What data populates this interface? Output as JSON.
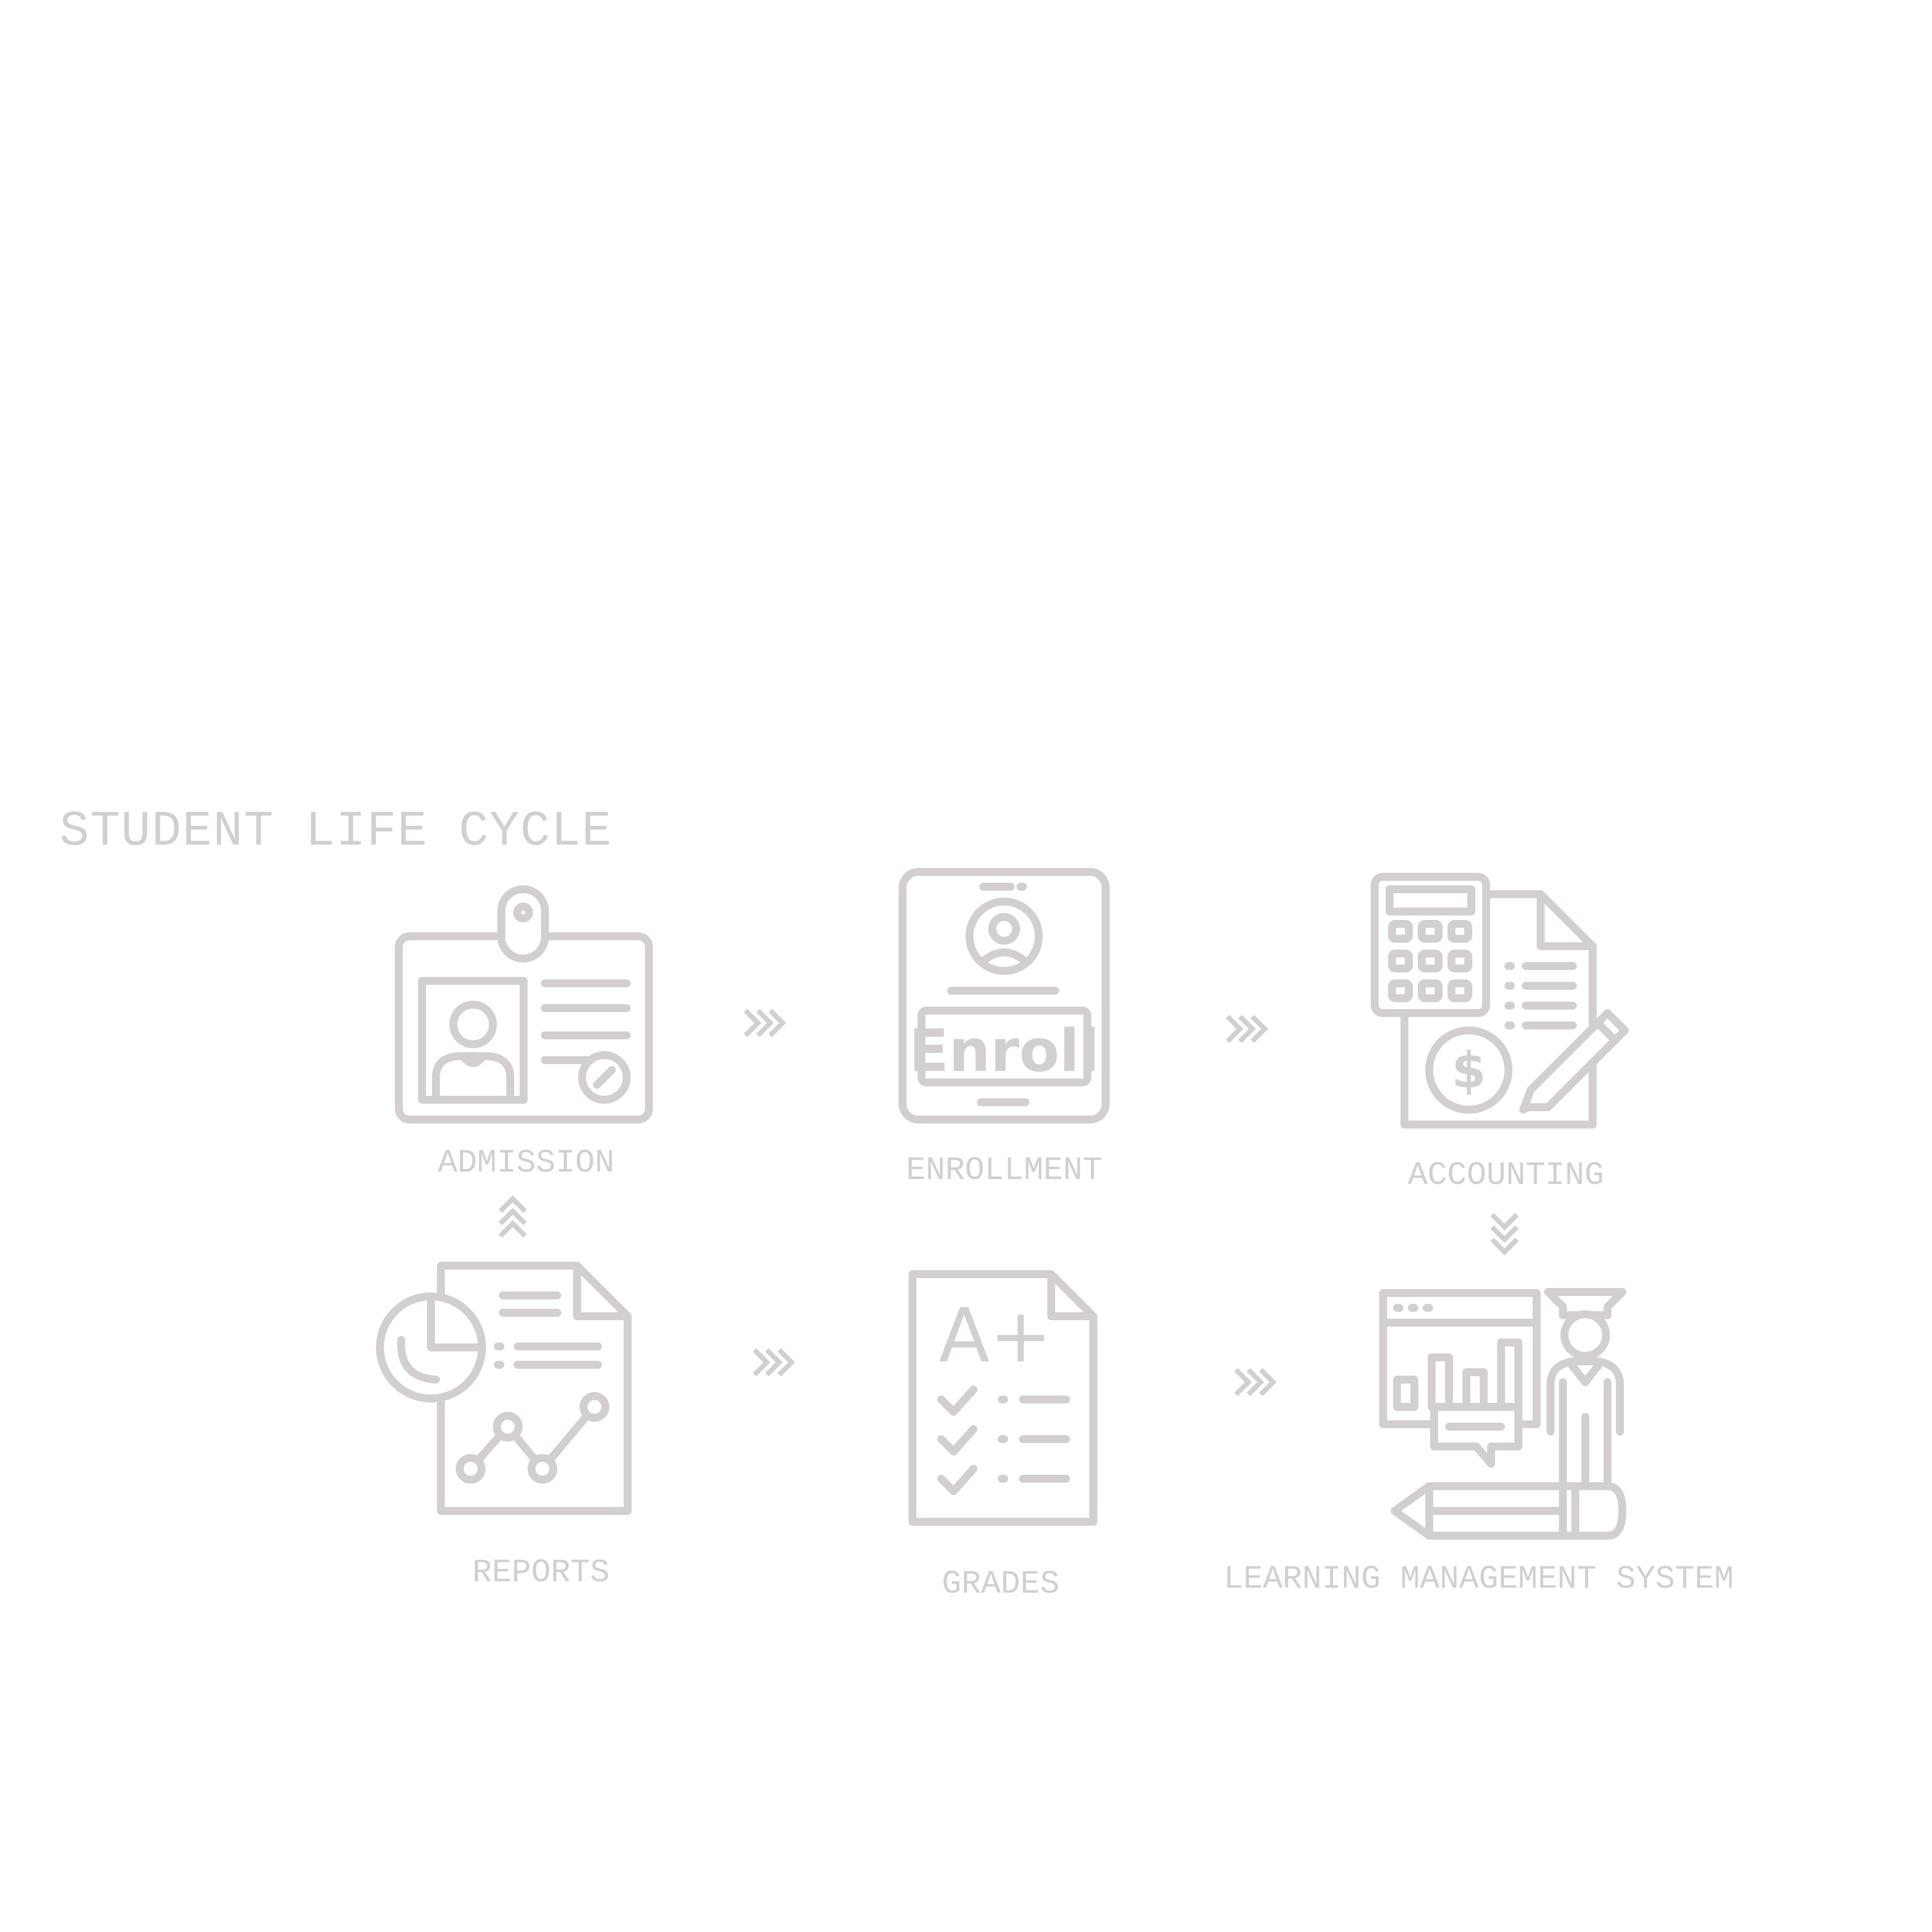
{
  "title": "STUDENT LIFE CYCLE",
  "colors": {
    "ink": "#d3cfcf",
    "background": "#ffffff"
  },
  "steps": [
    {
      "id": "admission",
      "label": "ADMISSION",
      "icon": "id-badge-icon"
    },
    {
      "id": "enrollment",
      "label": "ENROLLMENT",
      "icon": "enroll-tablet-icon",
      "icon_text": "Enroll"
    },
    {
      "id": "accounting",
      "label": "ACCOUNTING",
      "icon": "calculator-invoice-icon",
      "icon_text": "$"
    },
    {
      "id": "lms",
      "label": "LEARNING MANAGEMENT SYSTEM",
      "icon": "graduate-dashboard-icon"
    },
    {
      "id": "grades",
      "label": "GRADES",
      "icon": "graded-paper-icon",
      "icon_text": "A+"
    },
    {
      "id": "reports",
      "label": "REPORTS",
      "icon": "report-chart-icon"
    }
  ],
  "flow": [
    {
      "from": "admission",
      "to": "enrollment",
      "direction": "right"
    },
    {
      "from": "enrollment",
      "to": "accounting",
      "direction": "right"
    },
    {
      "from": "accounting",
      "to": "lms",
      "direction": "down"
    },
    {
      "from": "reports",
      "to": "grades",
      "direction": "right"
    },
    {
      "from": "grades",
      "to": "lms",
      "direction": "right"
    },
    {
      "from": "reports",
      "to": "admission",
      "direction": "up"
    }
  ]
}
